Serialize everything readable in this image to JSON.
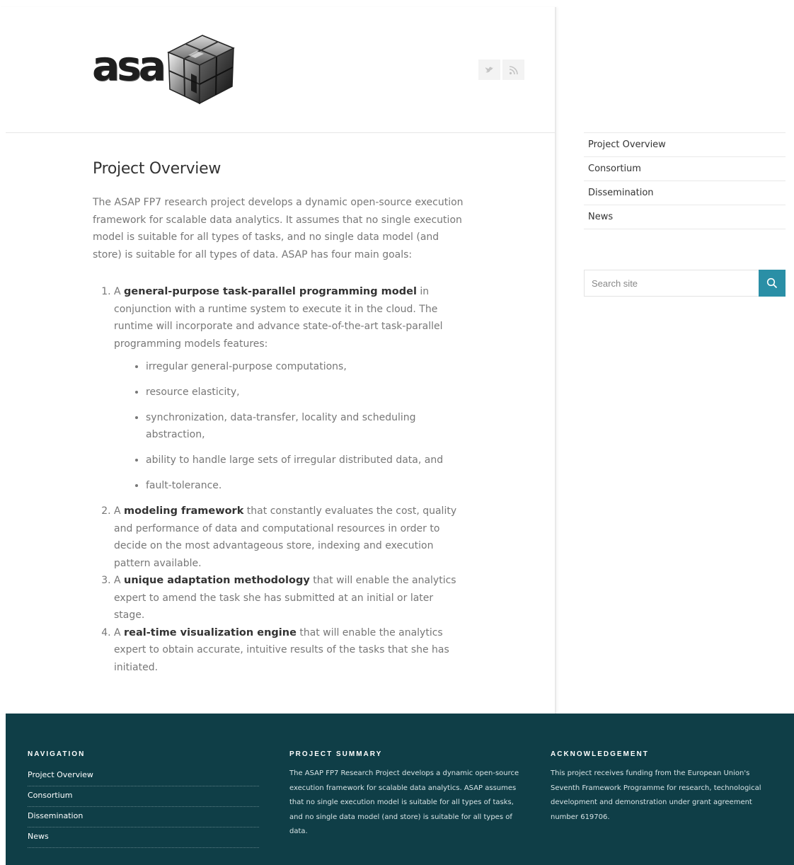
{
  "header": {
    "logo_text": "asa",
    "social": [
      {
        "name": "twitter-icon",
        "label": "Twitter"
      },
      {
        "name": "rss-icon",
        "label": "RSS"
      }
    ]
  },
  "main": {
    "title": "Project Overview",
    "intro": "The ASAP FP7 research project develops a dynamic open-source execution framework for scalable data analytics. It assumes that no single execution model is suitable for all types of tasks, and no single data model (and store) is suitable for all types of data. ASAP has four main goals:",
    "goals": [
      {
        "prefix": "A ",
        "bold": "general-purpose task-parallel programming model",
        "rest": " in conjunction with a runtime system to execute it in the cloud. The runtime will incorporate and advance state-of-the-art task-parallel programming models features:",
        "features": [
          "irregular general-purpose computations,",
          "resource elasticity,",
          "synchronization, data-transfer, locality and scheduling abstraction,",
          "ability to handle large sets of irregular distributed data, and",
          "fault-tolerance."
        ]
      },
      {
        "prefix": "A ",
        "bold": "modeling framework",
        "rest": " that constantly evaluates the cost, quality and performance of data and computational resources in order to decide on the most advantageous store, indexing and execution pattern available."
      },
      {
        "prefix": "A ",
        "bold": "unique adaptation methodology",
        "rest": " that will enable the analytics expert to amend the task she has submitted at an initial or later stage."
      },
      {
        "prefix": "A ",
        "bold": "real-time visualization engine",
        "rest": " that will enable the analytics expert to obtain accurate, intuitive results of the tasks that she has initiated."
      }
    ]
  },
  "sidebar": {
    "nav": [
      "Project Overview",
      "Consortium",
      "Dissemination",
      "News"
    ],
    "search": {
      "placeholder": "Search site",
      "value": ""
    }
  },
  "footer": {
    "navigation": {
      "heading": "NAVIGATION",
      "items": [
        "Project Overview",
        "Consortium",
        "Dissemination",
        "News"
      ]
    },
    "summary": {
      "heading": "PROJECT SUMMARY",
      "text": "The ASAP FP7 Research Project develops a dynamic open-source execution framework for scalable data analytics. ASAP assumes that no single execution model is suitable for all types of tasks, and no single data model (and store) is suitable for all types of data."
    },
    "acknowledgement": {
      "heading": "ACKNOWLEDGEMENT",
      "text": "This project receives funding from the European Union's Seventh Framework Programme for research, technological development and demonstration under grant agreement number 619706."
    }
  },
  "colors": {
    "accent": "#2a8fa6",
    "footer_bg": "#0f3e47",
    "heading": "#333333",
    "body_text": "#777777"
  }
}
